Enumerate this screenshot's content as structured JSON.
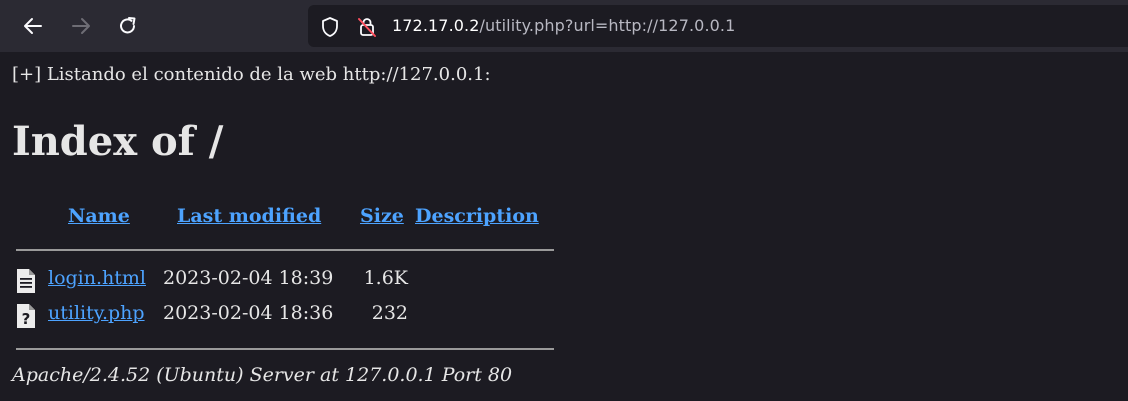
{
  "browser": {
    "url_host": "172.17.0.2",
    "url_path": "/utility.php?url=http://127.0.0.1",
    "icons": [
      "back-arrow-icon",
      "forward-arrow-icon",
      "reload-icon",
      "shield-icon",
      "insecure-lock-icon"
    ]
  },
  "page": {
    "message": "[+] Listando el contenido de la web http://127.0.0.1:",
    "heading": "Index of /",
    "columns": {
      "name": "Name",
      "last_modified": "Last modified",
      "size": "Size",
      "description": "Description"
    },
    "files": [
      {
        "name": "login.html",
        "modified": "2023-02-04 18:39",
        "size": "1.6K",
        "icon": "text-file-icon"
      },
      {
        "name": "utility.php",
        "modified": "2023-02-04 18:36",
        "size": "232",
        "icon": "unknown-file-icon"
      }
    ],
    "address": "Apache/2.4.52 (Ubuntu) Server at 127.0.0.1 Port 80"
  },
  "colors": {
    "link": "#4da3ff",
    "background": "#1c1b22",
    "toolbar": "#2b2a33",
    "text": "#e6e6e6"
  }
}
